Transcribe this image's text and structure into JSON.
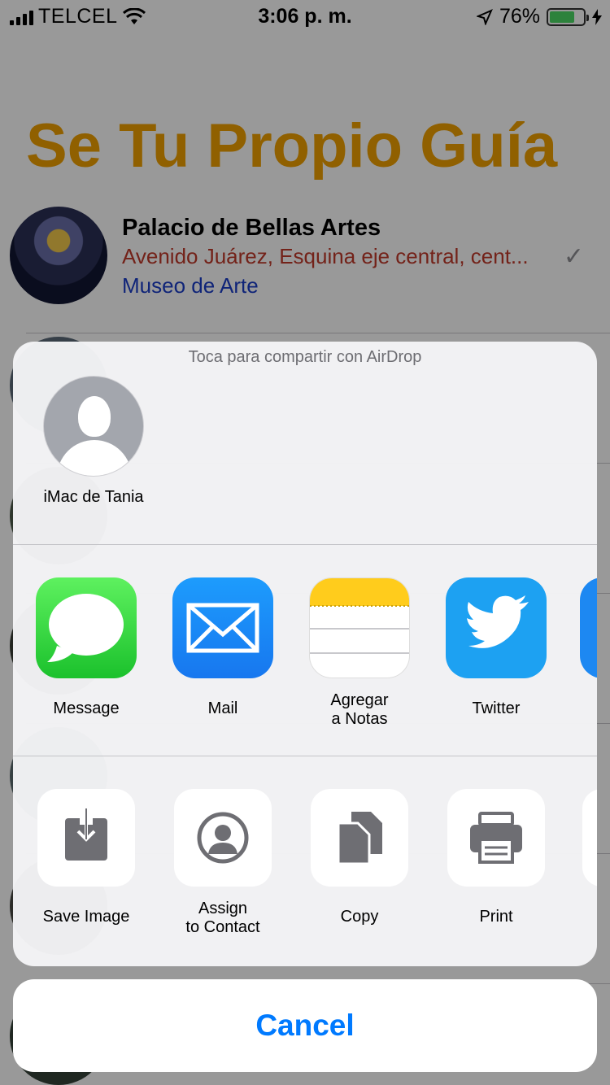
{
  "status_bar": {
    "carrier": "TELCEL",
    "time": "3:06 p. m.",
    "battery_percent": "76%",
    "battery_level": 0.76,
    "battery_color": "#4cd964"
  },
  "app": {
    "title": "Se Tu Propio Guía",
    "title_color": "#f0a000",
    "list": [
      {
        "name": "Palacio de Bellas Artes",
        "address": "Avenido Juárez, Esquina eje central, cent...",
        "category": "Museo de Arte",
        "checked": true
      }
    ]
  },
  "share_sheet": {
    "airdrop_title": "Toca para compartir con AirDrop",
    "airdrop_contact": {
      "name": "iMac de Tania",
      "icon": "person-placeholder-icon"
    },
    "apps": [
      {
        "label": "Message",
        "icon": "messages-icon"
      },
      {
        "label": "Mail",
        "icon": "mail-icon"
      },
      {
        "label": "Agregar\na Notas",
        "icon": "notes-icon"
      },
      {
        "label": "Twitter",
        "icon": "twitter-icon"
      }
    ],
    "actions": [
      {
        "label": "Save Image",
        "icon": "save-image-icon"
      },
      {
        "label": "Assign\nto Contact",
        "icon": "assign-contact-icon"
      },
      {
        "label": "Copy",
        "icon": "copy-icon"
      },
      {
        "label": "Print",
        "icon": "print-icon"
      }
    ],
    "cancel_label": "Cancel",
    "accent_color": "#007aff"
  }
}
